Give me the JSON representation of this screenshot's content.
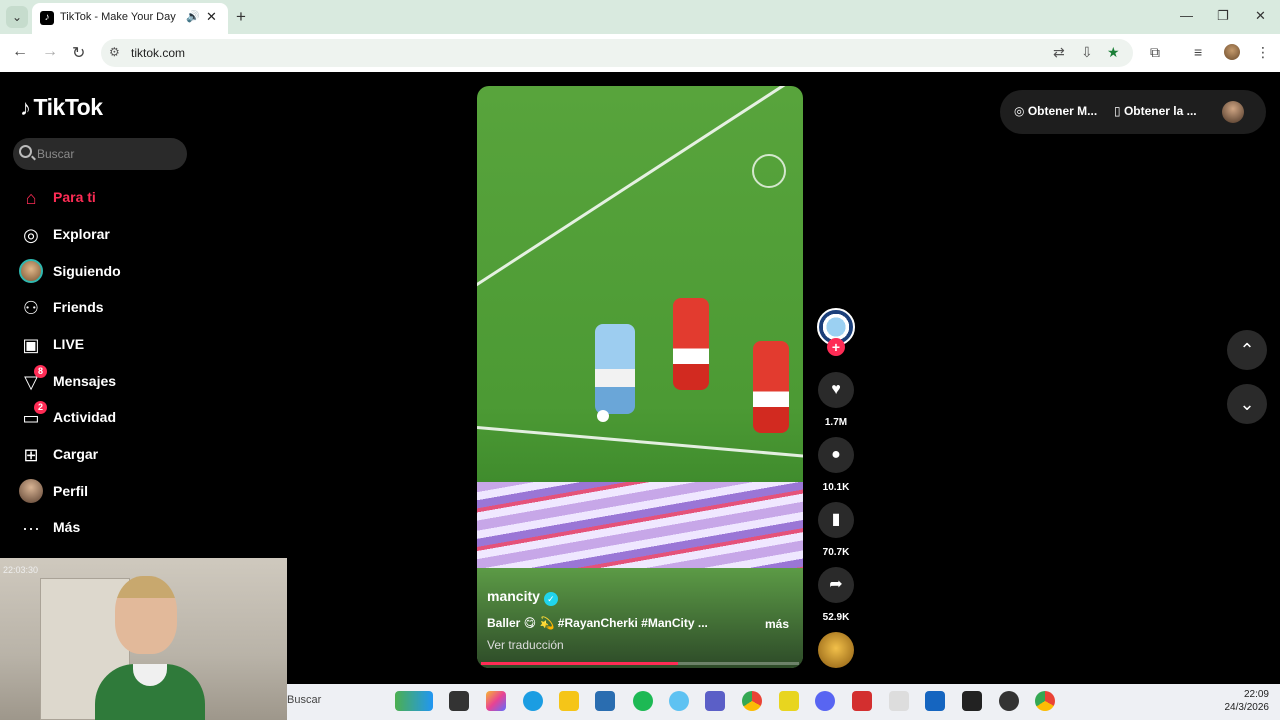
{
  "browser": {
    "tab_title": "TikTok - Make Your Day",
    "url": "tiktok.com"
  },
  "app": {
    "logo_text": "TikTok",
    "search_placeholder": "Buscar"
  },
  "sidebar": {
    "items": [
      {
        "label": "Para ti",
        "icon": "home-icon",
        "active": true
      },
      {
        "label": "Explorar",
        "icon": "compass-icon"
      },
      {
        "label": "Siguiendo",
        "icon": "avatar"
      },
      {
        "label": "Friends",
        "icon": "people-icon"
      },
      {
        "label": "LIVE",
        "icon": "live-tv-icon"
      },
      {
        "label": "Mensajes",
        "icon": "send-icon",
        "badge": "8"
      },
      {
        "label": "Actividad",
        "icon": "chat-icon",
        "badge": "2"
      },
      {
        "label": "Cargar",
        "icon": "plus-square-icon"
      },
      {
        "label": "Perfil",
        "icon": "avatar"
      },
      {
        "label": "Más",
        "icon": "more-icon"
      }
    ]
  },
  "webcam": {
    "timestamp": "22:03:30"
  },
  "video": {
    "username": "mancity",
    "caption": "Baller 😋 💫 #RayanCherki #ManCity ...",
    "more_label": "más",
    "translate_label": "Ver traducción",
    "progress_fraction": 0.62
  },
  "actions": {
    "likes": "1.7M",
    "comments": "10.1K",
    "saves": "70.7K",
    "shares": "52.9K"
  },
  "top_right": {
    "get_app_label": "Obtener M...",
    "get_desktop_label": "Obtener la ..."
  },
  "taskbar": {
    "search_label": "Buscar",
    "time": "22:09",
    "date": "24/3/2026"
  },
  "colors": {
    "accent": "#fe2c55",
    "background": "#000000",
    "verified": "#20d5ec"
  }
}
